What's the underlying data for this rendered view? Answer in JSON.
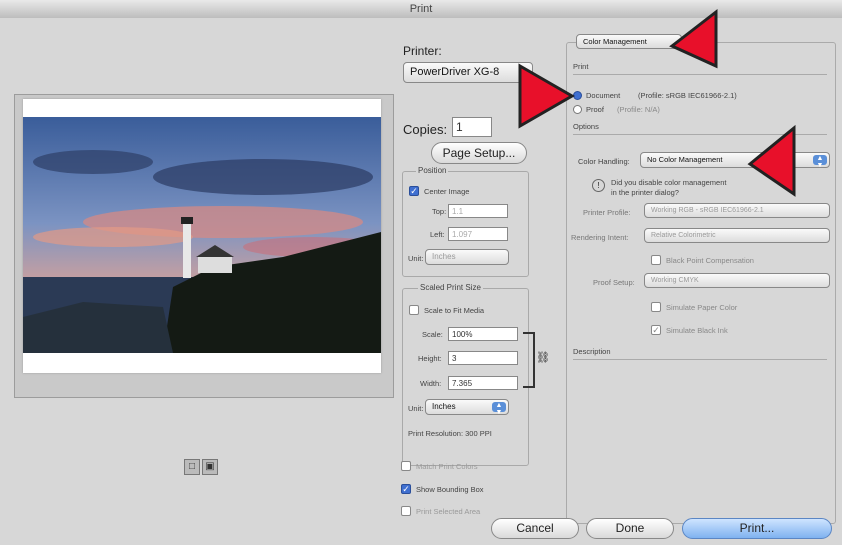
{
  "window": {
    "title": "Print"
  },
  "printer": {
    "label": "Printer:",
    "selected": "PowerDriver XG-8",
    "copies_label": "Copies:",
    "copies_value": "1",
    "page_setup_label": "Page Setup..."
  },
  "position": {
    "group_title": "Position",
    "center_image_label": "Center Image",
    "top_label": "Top:",
    "top_value": "1.1",
    "left_label": "Left:",
    "left_value": "1.097",
    "unit_label": "Unit:",
    "unit_value": "Inches"
  },
  "scaled": {
    "group_title": "Scaled Print Size",
    "scale_to_fit_label": "Scale to Fit Media",
    "scale_label": "Scale:",
    "scale_value": "100%",
    "height_label": "Height:",
    "height_value": "3",
    "width_label": "Width:",
    "width_value": "7.365",
    "unit_label": "Unit:",
    "unit_value": "Inches",
    "resolution": "Print Resolution: 300 PPI"
  },
  "options": {
    "match_print_colors": "Match Print Colors",
    "show_bounding_box": "Show Bounding Box",
    "print_selected_area": "Print Selected Area"
  },
  "color_mgmt": {
    "section_popup": "Color Management",
    "print_label": "Print",
    "document_label": "Document",
    "document_profile": "(Profile: sRGB IEC61966-2.1)",
    "proof_label": "Proof",
    "proof_profile": "(Profile: N/A)",
    "options_label": "Options",
    "color_handling_label": "Color Handling:",
    "color_handling_value": "No Color Management",
    "hint_line1": "Did you disable color management",
    "hint_line2": "in the printer dialog?",
    "printer_profile_label": "Printer Profile:",
    "printer_profile_value": "Working RGB - sRGB IEC61966-2.1",
    "rendering_intent_label": "Rendering Intent:",
    "rendering_intent_value": "Relative Colorimetric",
    "black_point_label": "Black Point Compensation",
    "proof_setup_label": "Proof Setup:",
    "proof_setup_value": "Working CMYK",
    "simulate_paper_label": "Simulate Paper Color",
    "simulate_black_label": "Simulate Black Ink",
    "description_label": "Description"
  },
  "buttons": {
    "cancel": "Cancel",
    "done": "Done",
    "print": "Print..."
  },
  "colors": {
    "accent": "#3f6fd0",
    "annotation_arrow": "#e8102a"
  }
}
